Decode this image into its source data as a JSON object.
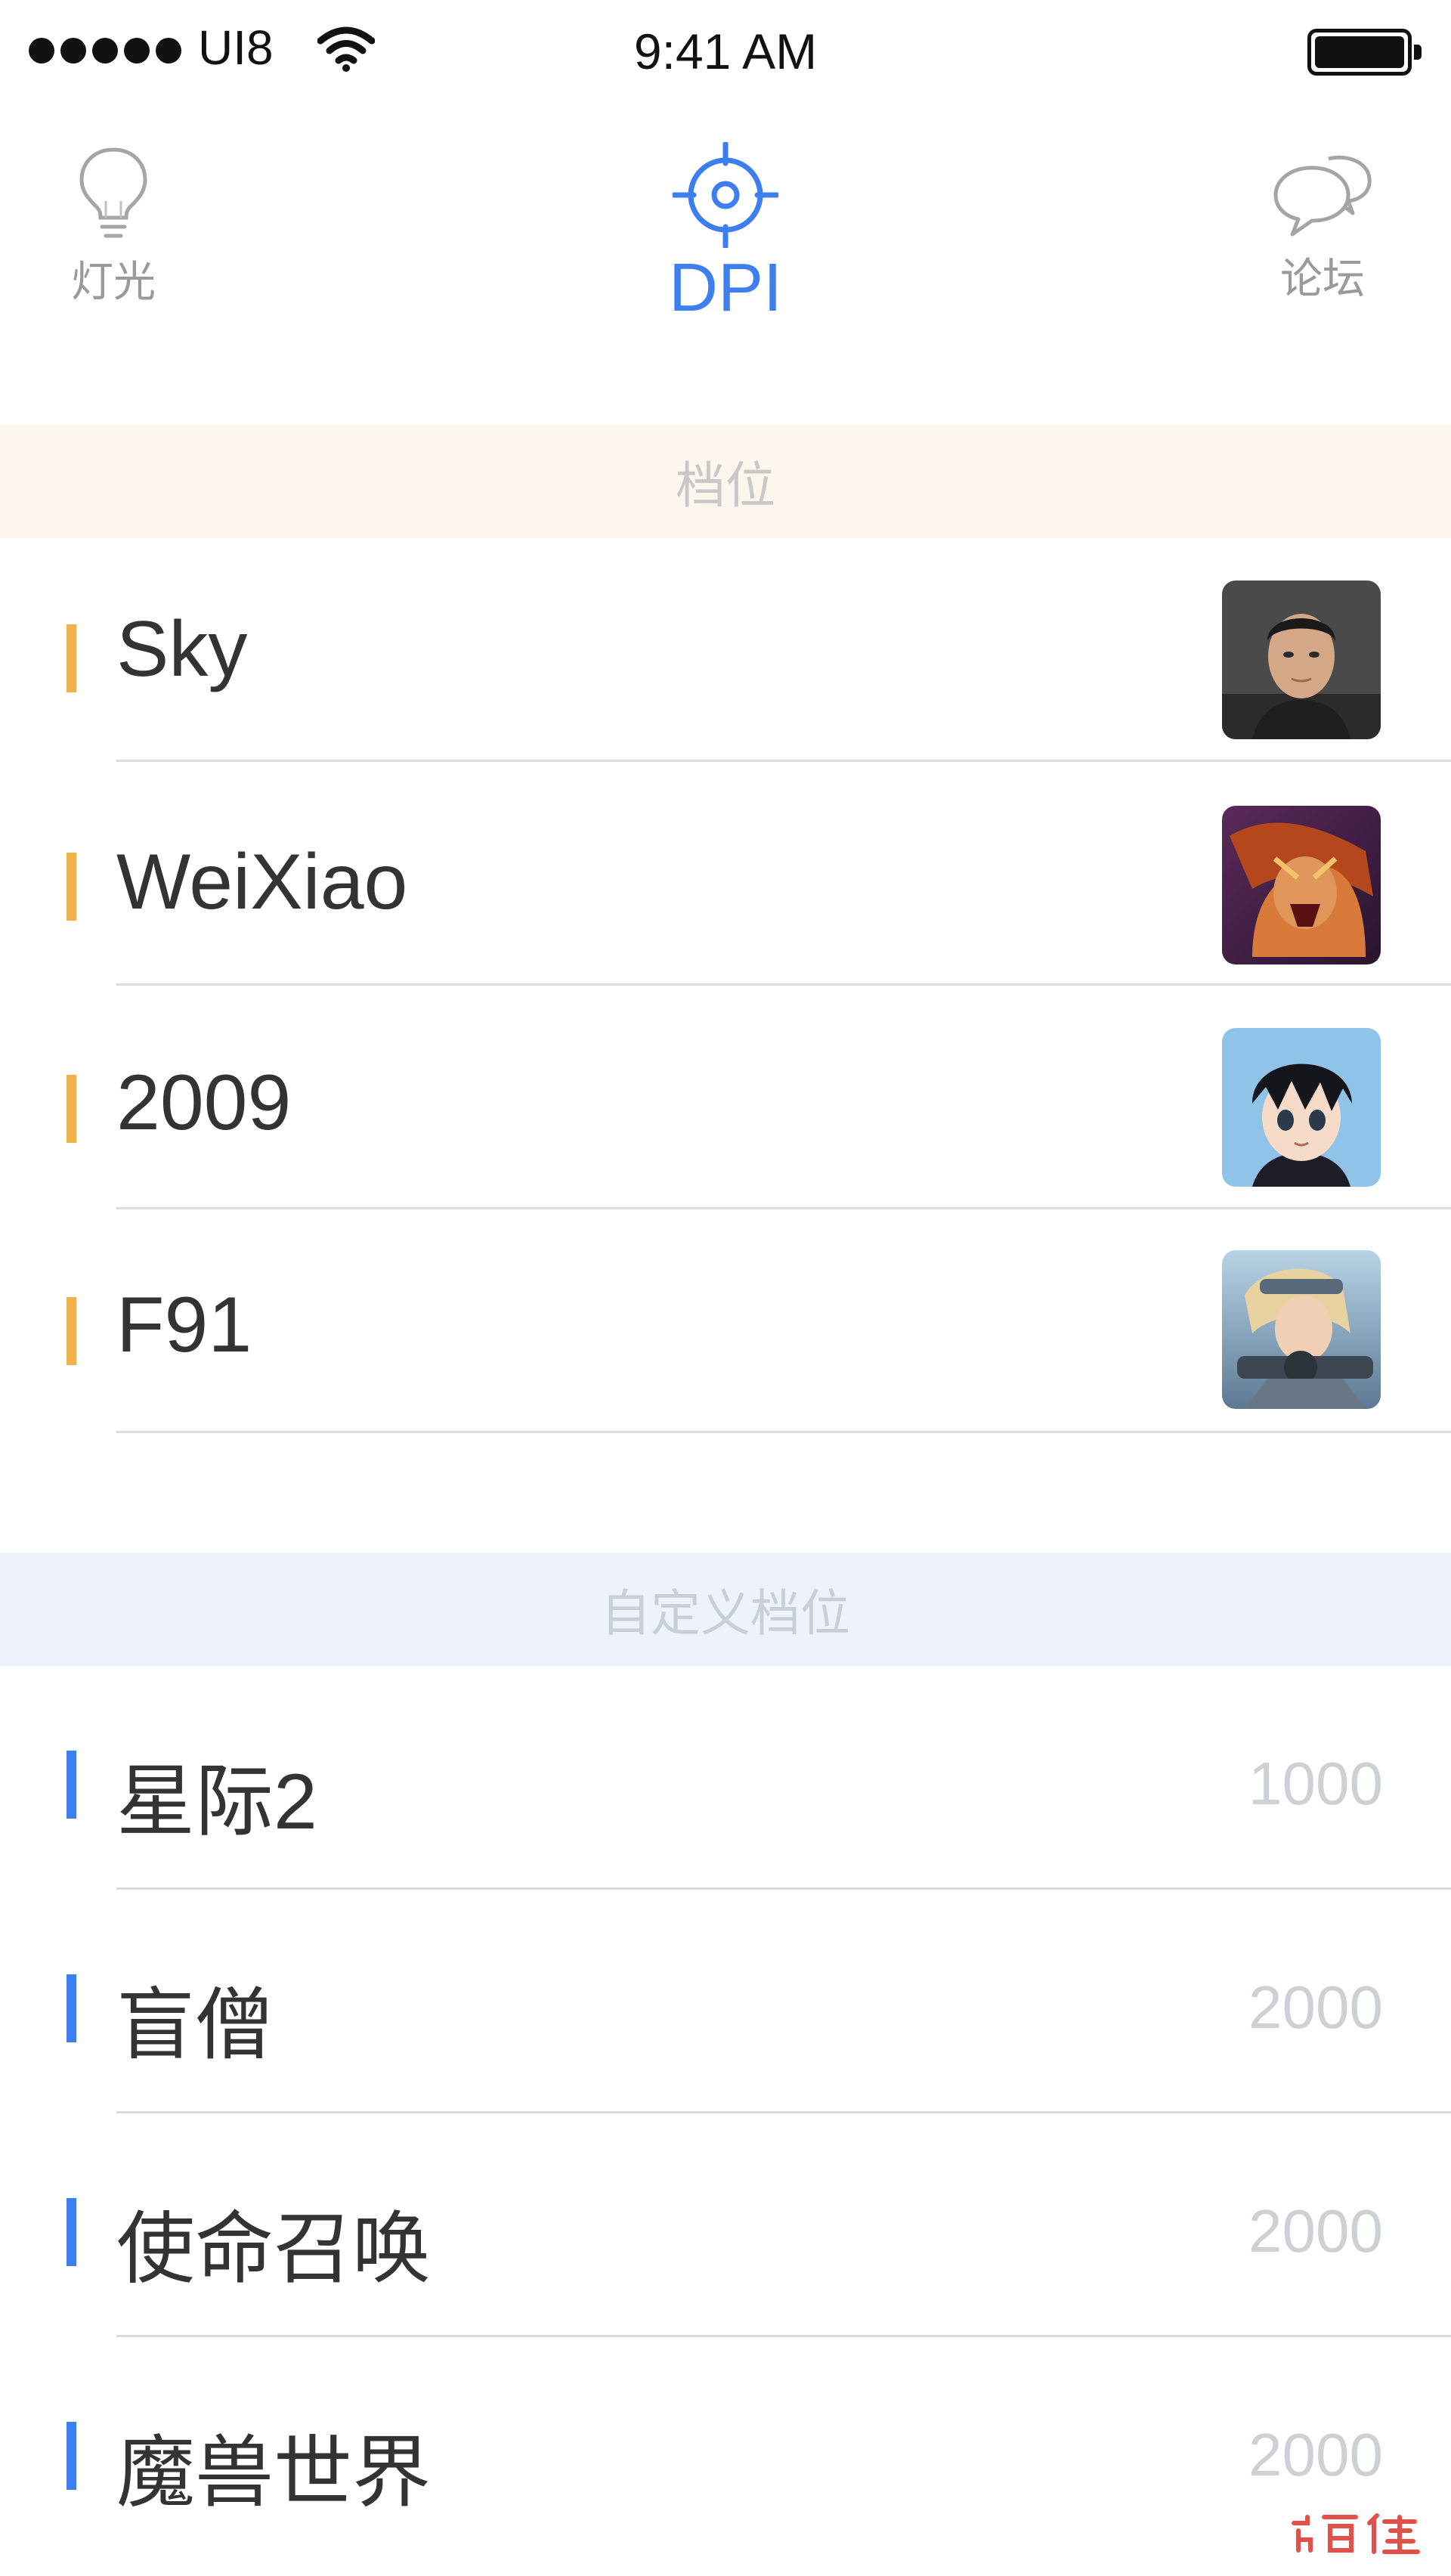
{
  "status_bar": {
    "carrier": "UI8",
    "time": "9:41 AM"
  },
  "tabs": {
    "light": {
      "label": "灯光",
      "icon": "lightbulb-icon"
    },
    "dpi": {
      "label": "DPI",
      "icon": "crosshair-icon",
      "active": true
    },
    "forum": {
      "label": "论坛",
      "icon": "chat-bubbles-icon"
    }
  },
  "colors": {
    "accent": "#3d7ff0",
    "preset_marker": "#f0b24a",
    "custom_marker": "#3d7ff0",
    "preset_header_bg": "#fdf6ec",
    "custom_header_bg": "#edf2fb"
  },
  "presets": {
    "title": "档位",
    "items": [
      {
        "name": "Sky",
        "avatar": "player-photo"
      },
      {
        "name": "WeiXiao",
        "avatar": "warrior-art"
      },
      {
        "name": "2009",
        "avatar": "anime-boy-art"
      },
      {
        "name": "F91",
        "avatar": "sniper-art"
      }
    ]
  },
  "custom": {
    "title": "自定义档位",
    "items": [
      {
        "name": "星际2",
        "value": "1000"
      },
      {
        "name": "盲僧",
        "value": "2000"
      },
      {
        "name": "使命召唤",
        "value": "2000"
      },
      {
        "name": "魔兽世界",
        "value": "2000"
      }
    ]
  }
}
